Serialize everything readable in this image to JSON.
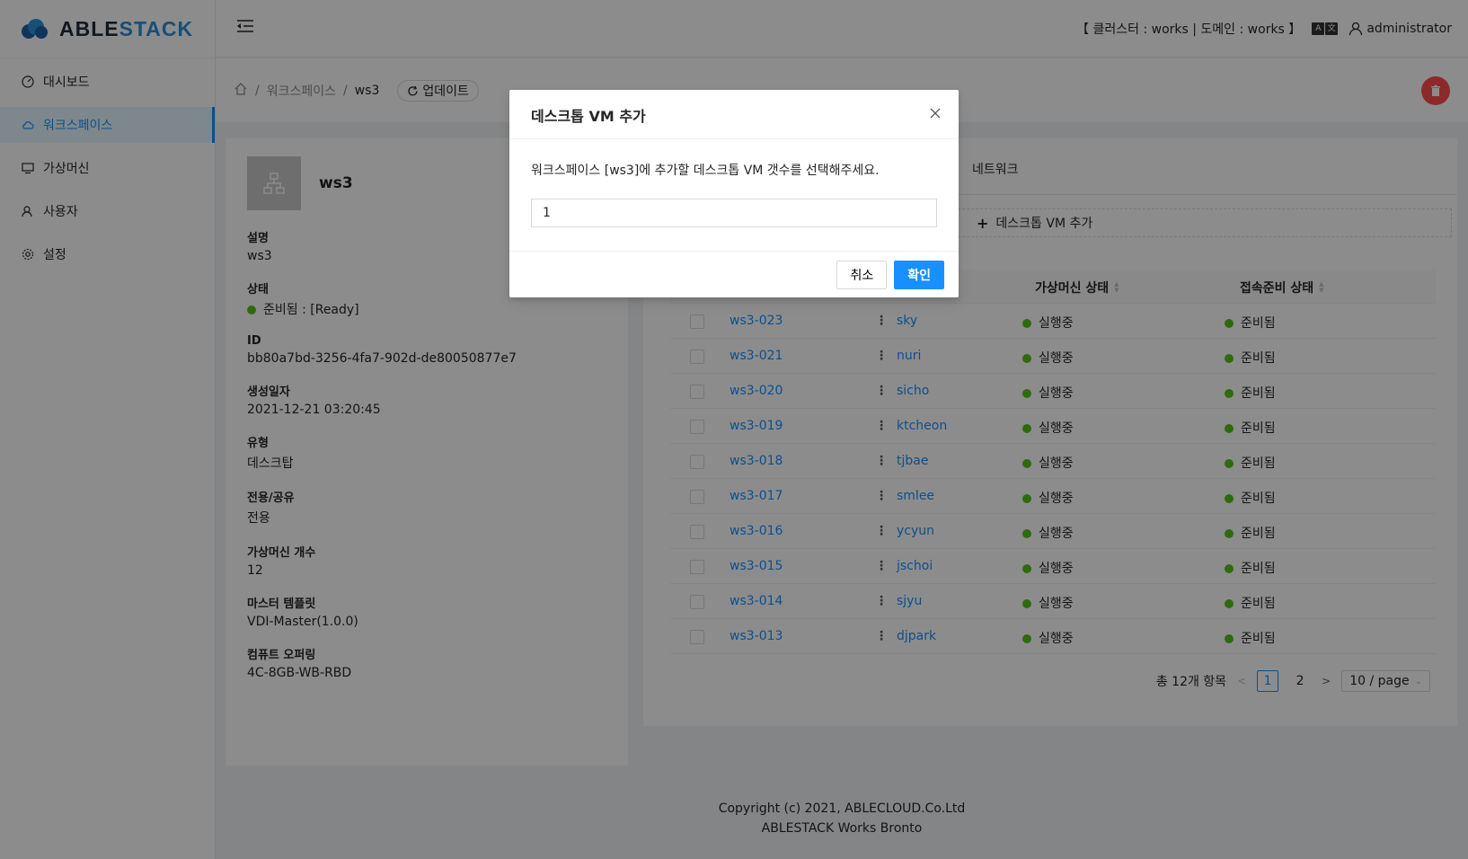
{
  "app": {
    "logo_able": "ABLE",
    "logo_stack": "STACK"
  },
  "sidebar": {
    "items": [
      {
        "label": "대시보드",
        "icon": "dashboard-icon"
      },
      {
        "label": "워크스페이스",
        "icon": "cloud-icon",
        "active": true
      },
      {
        "label": "가상머신",
        "icon": "desktop-icon"
      },
      {
        "label": "사용자",
        "icon": "users-icon"
      },
      {
        "label": "설정",
        "icon": "gear-icon"
      }
    ]
  },
  "header": {
    "cluster_info": "【 클러스터 : works  |  도메인 : works 】",
    "user_name": "administrator"
  },
  "breadcrumb": {
    "workspaces": "워크스페이스",
    "current": "ws3",
    "update_label": "업데이트"
  },
  "workspace": {
    "name": "ws3",
    "fields": [
      {
        "label": "설명",
        "value": "ws3"
      },
      {
        "label": "상태",
        "value": "준비됨 : [Ready]",
        "status_color": "#52c41a"
      },
      {
        "label": "ID",
        "value": "bb80a7bd-3256-4fa7-902d-de80050877e7"
      },
      {
        "label": "생성일자",
        "value": "2021-12-21 03:20:45"
      },
      {
        "label": "유형",
        "value": "데스크탑"
      },
      {
        "label": "전용/공유",
        "value": "전용"
      },
      {
        "label": "가상머신 개수",
        "value": "12"
      },
      {
        "label": "마스터 템플릿",
        "value": "VDI-Master(1.0.0)"
      },
      {
        "label": "컴퓨트 오퍼링",
        "value": "4C-8GB-WB-RBD"
      }
    ]
  },
  "vm_panel": {
    "tab_network": "네트워크",
    "add_button": "데스크톱 VM 추가",
    "columns": {
      "vm_state": "가상머신 상태",
      "conn_state": "접속준비 상태"
    },
    "rows": [
      {
        "name": "ws3-023",
        "user": "sky",
        "vm_state": "실행중",
        "conn_state": "준비됨"
      },
      {
        "name": "ws3-021",
        "user": "nuri",
        "vm_state": "실행중",
        "conn_state": "준비됨"
      },
      {
        "name": "ws3-020",
        "user": "sicho",
        "vm_state": "실행중",
        "conn_state": "준비됨"
      },
      {
        "name": "ws3-019",
        "user": "ktcheon",
        "vm_state": "실행중",
        "conn_state": "준비됨"
      },
      {
        "name": "ws3-018",
        "user": "tjbae",
        "vm_state": "실행중",
        "conn_state": "준비됨"
      },
      {
        "name": "ws3-017",
        "user": "smlee",
        "vm_state": "실행중",
        "conn_state": "준비됨"
      },
      {
        "name": "ws3-016",
        "user": "ycyun",
        "vm_state": "실행중",
        "conn_state": "준비됨"
      },
      {
        "name": "ws3-015",
        "user": "jschoi",
        "vm_state": "실행중",
        "conn_state": "준비됨"
      },
      {
        "name": "ws3-014",
        "user": "sjyu",
        "vm_state": "실행중",
        "conn_state": "준비됨"
      },
      {
        "name": "ws3-013",
        "user": "djpark",
        "vm_state": "실행중",
        "conn_state": "준비됨"
      }
    ],
    "pagination": {
      "total": "총 12개 항목",
      "pages": [
        "1",
        "2"
      ],
      "current_page": "1",
      "page_size": "10 / page"
    }
  },
  "footer": {
    "line1": "Copyright (c) 2021, ABLECLOUD.Co.Ltd",
    "line2": "ABLESTACK Works Bronto"
  },
  "modal": {
    "title": "데스크톱 VM 추가",
    "message": "워크스페이스 [ws3]에 추가할 데스크톱 VM 갯수를 선택해주세요.",
    "input_value": "1",
    "cancel_label": "취소",
    "ok_label": "확인"
  },
  "colors": {
    "primary": "#1890ff",
    "success": "#52c41a",
    "danger": "#ff4d4f"
  }
}
